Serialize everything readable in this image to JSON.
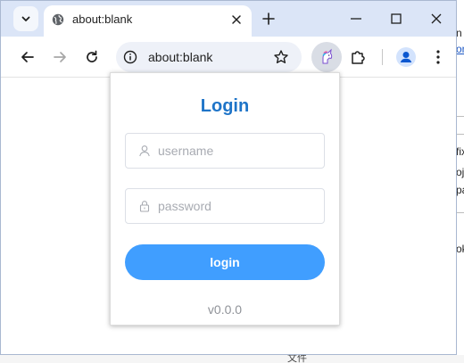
{
  "browser": {
    "tab_title": "about:blank",
    "address": "about:blank"
  },
  "popup": {
    "title": "Login",
    "username_placeholder": "username",
    "password_placeholder": "password",
    "login_label": "login",
    "version": "v0.0.0"
  },
  "background": {
    "frag1": "n",
    "frag2": "on",
    "frag3": "fix",
    "frag4": "oj",
    "frag5": "pa",
    "frag6": "ok",
    "bottom_text": "文件"
  },
  "colors": {
    "accent": "#409eff",
    "title": "#1e74c8",
    "titlebar": "#dbe5f7"
  },
  "icons": [
    "chevron-down-icon",
    "globe-icon",
    "close-icon",
    "plus-icon",
    "minimize-icon",
    "maximize-icon",
    "back-icon",
    "forward-icon",
    "reload-icon",
    "info-icon",
    "star-icon",
    "unicorn-extension-icon",
    "puzzle-icon",
    "profile-icon",
    "more-icon",
    "user-icon",
    "lock-icon"
  ]
}
